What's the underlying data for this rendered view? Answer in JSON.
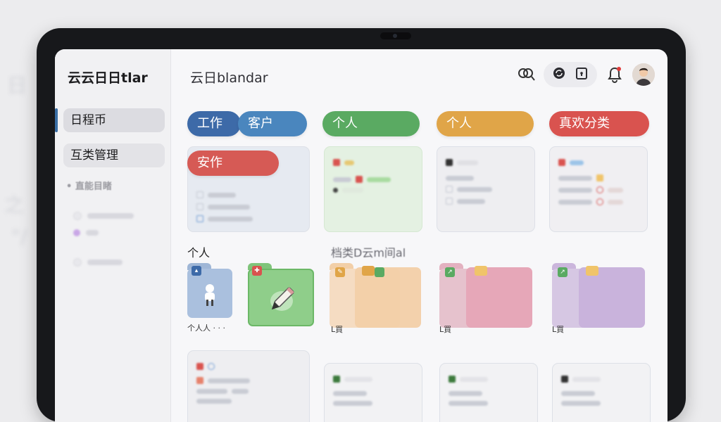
{
  "app": {
    "title": "云云日日tlar",
    "brand": "云日blandar"
  },
  "sidebar": {
    "items": [
      {
        "label": "日程币",
        "active": true
      },
      {
        "label": "互类管理",
        "active": false
      }
    ],
    "group_label": "直能目睹",
    "blurred_rows": [
      {
        "color": "#d8d8de"
      },
      {
        "color": "#c9a7e6"
      },
      {
        "color": "#d8d8de"
      }
    ]
  },
  "header": {
    "icons": [
      "search-icon",
      "sync-icon",
      "lock-icon",
      "bell-icon",
      "avatar"
    ]
  },
  "chips": [
    {
      "label": "工作",
      "color": "#3d6aa8"
    },
    {
      "label": "客户",
      "color": "#4a86be"
    },
    {
      "label": "个人",
      "color": "#5aaa62"
    },
    {
      "label": "个人",
      "color": "#e0a548"
    },
    {
      "label": "真欢分类",
      "color": "#d9534f"
    },
    {
      "label": "安作",
      "color": "#d65a55"
    }
  ],
  "sections": {
    "personal_title": "个人",
    "blurred_title": "档类D云m间al"
  },
  "folders": [
    {
      "label": "个人人 · · ·",
      "color": "#aac0de"
    },
    {
      "label": "",
      "color": "#8fce8a"
    },
    {
      "label": "L買",
      "color": "#f2cfa8"
    },
    {
      "label": "L買",
      "color": "#e6a7b8"
    },
    {
      "label": "L買",
      "color": "#c9b3dc"
    }
  ]
}
